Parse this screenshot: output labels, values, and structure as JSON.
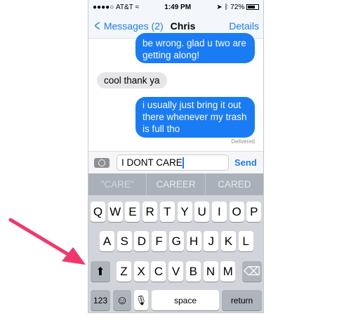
{
  "status": {
    "carrier": "AT&T",
    "signal_dots": "●●●●○",
    "wifi": "wifi-icon",
    "time": "1:49 PM",
    "battery": "72%"
  },
  "nav": {
    "back_label": "Messages (2)",
    "title": "Chris",
    "details": "Details"
  },
  "messages": [
    {
      "from": "me",
      "text": "be wrong. glad u two are getting along!"
    },
    {
      "from": "them",
      "text": "cool thank ya"
    },
    {
      "from": "me",
      "text": "i usually just bring it out there whenever my trash is full tho"
    }
  ],
  "delivered": "Delivered",
  "input": {
    "value": "I DONT CARE",
    "send": "Send"
  },
  "suggestions": [
    "\"CARE\"",
    "CAREER",
    "CARED"
  ],
  "keyboard": {
    "row1": [
      "Q",
      "W",
      "E",
      "R",
      "T",
      "Y",
      "U",
      "I",
      "O",
      "P"
    ],
    "row2": [
      "A",
      "S",
      "D",
      "F",
      "G",
      "H",
      "J",
      "K",
      "L"
    ],
    "row3": [
      "Z",
      "X",
      "C",
      "V",
      "B",
      "N",
      "M"
    ],
    "numbers": "123",
    "space": "space",
    "return": "return"
  },
  "colors": {
    "accent": "#1a7cf5",
    "arrow": "#f0386b"
  }
}
